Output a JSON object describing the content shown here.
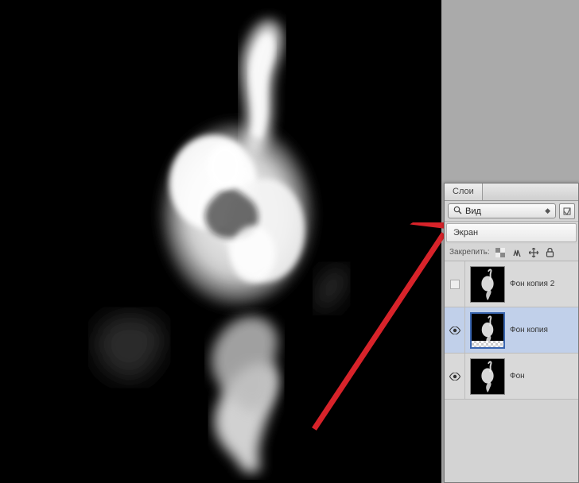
{
  "panel": {
    "tab_label": "Слои",
    "filter": "Вид",
    "blend_mode": "Экран",
    "lock_label": "Закрепить:"
  },
  "layers": [
    {
      "name": "Фон копия 2",
      "visible": false,
      "selected": false,
      "checker": false
    },
    {
      "name": "Фон копия",
      "visible": true,
      "selected": true,
      "checker": true
    },
    {
      "name": "Фон",
      "visible": true,
      "selected": false,
      "checker": false
    }
  ]
}
